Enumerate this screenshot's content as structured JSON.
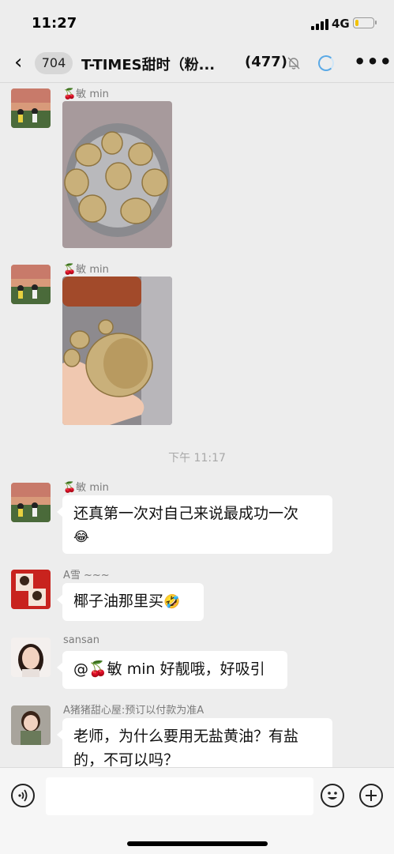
{
  "status_bar": {
    "time": "11:27",
    "network": "4G",
    "battery_level": 0.2
  },
  "nav": {
    "back_glyph": "‹",
    "unread_count": "704",
    "title": "T-TIMES甜时（粉...",
    "member_count": "(477)",
    "more_glyph": "•••",
    "icons": [
      "back-arrow-icon",
      "mute-bell-icon",
      "loading-spinner-icon",
      "more-icon"
    ]
  },
  "messages": [
    {
      "sender": "🍒敏 min",
      "type": "image",
      "description_icon": "photo"
    },
    {
      "sender": "🍒敏 min",
      "type": "image",
      "description_icon": "photo"
    },
    {
      "timestamp": "下午 11:17"
    },
    {
      "sender": "🍒敏 min",
      "type": "text",
      "text_line1": "还真第一次对自己来说最成功一次",
      "text_emoji": "😂"
    },
    {
      "sender": "A雪 ~~~",
      "type": "text",
      "text": "椰子油那里买",
      "text_emoji": "🤣"
    },
    {
      "sender": "sansan",
      "type": "text",
      "text": "@🍒敏 min 好靓哦，好吸引"
    },
    {
      "sender": "A猪猪甜心屋:预订以付款为准A",
      "type": "text",
      "text_line1": "老师，为什么要用无盐黄油？有盐",
      "text_line2": "的，不可以吗？"
    }
  ],
  "input_bar": {
    "voice_icon": "voice-icon",
    "emoji_icon": "emoji-icon",
    "plus_icon": "plus-icon"
  },
  "colors": {
    "background": "#ededed",
    "bubble": "#ffffff",
    "accent_spinner": "#5aa9e6",
    "battery": "#f2c200"
  }
}
